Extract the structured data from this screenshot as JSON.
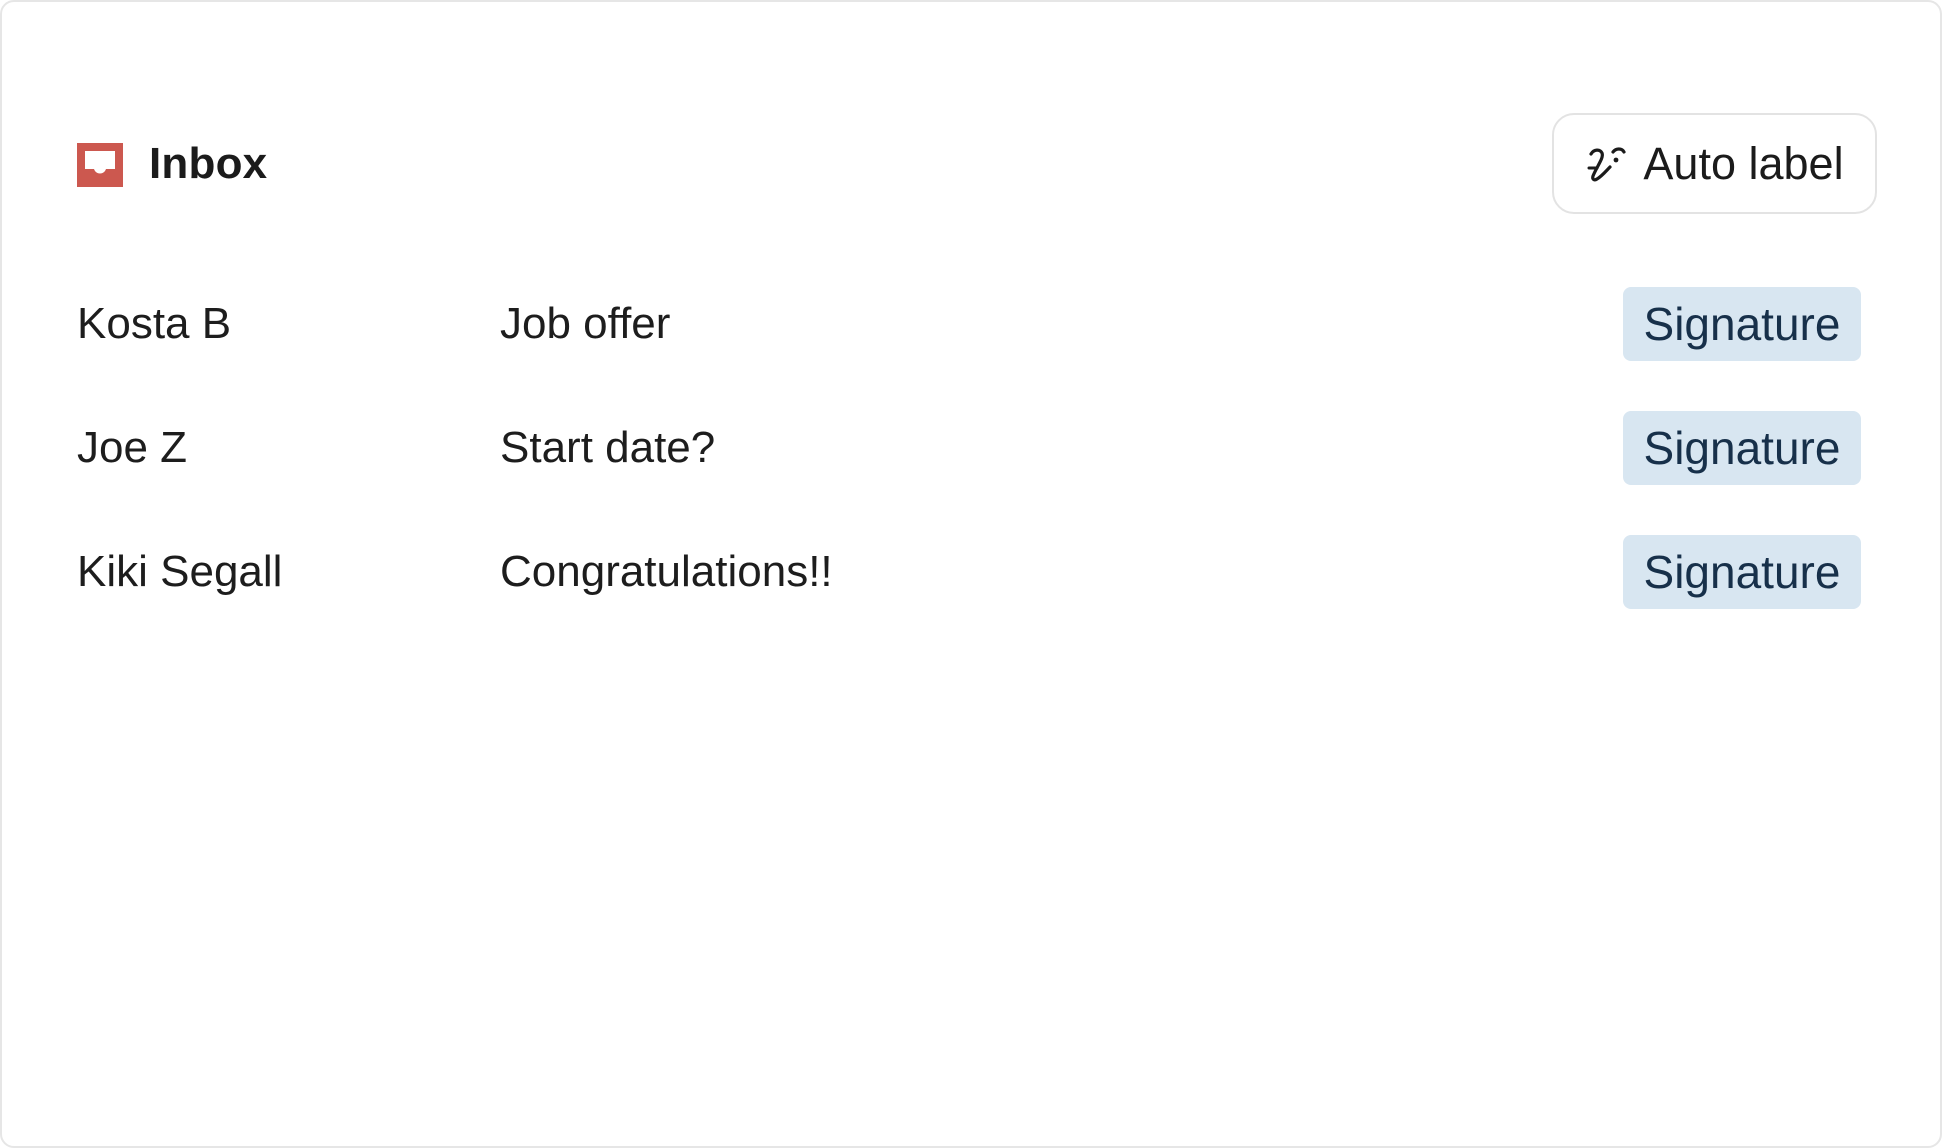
{
  "header": {
    "title": "Inbox",
    "title_icon": "inbox-tray-icon",
    "accent_color": "#cc584f",
    "auto_label_button": {
      "label": "Auto label",
      "icon": "magic-wand-icon"
    }
  },
  "emails": [
    {
      "sender": "Kosta B",
      "subject": "Job offer",
      "label": "Signature"
    },
    {
      "sender": "Joe Z",
      "subject": "Start date?",
      "label": "Signature"
    },
    {
      "sender": "Kiki Segall",
      "subject": "Congratulations!!",
      "label": "Signature"
    }
  ],
  "colors": {
    "tag_background": "#d8e6f1",
    "tag_text": "#17304a",
    "border": "#e3e3e3"
  }
}
